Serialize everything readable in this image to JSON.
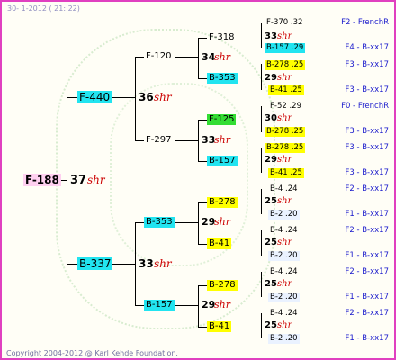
{
  "header": {
    "date_text": "30-  1-2012 ( 21: 22)"
  },
  "footer": {
    "copyright": "Copyright 2004-2012 @ Karl Kehde Foundation."
  },
  "root": {
    "name": "F-188",
    "num": "37",
    "shr": "shr"
  },
  "gen1": [
    {
      "name": "F-440"
    },
    {
      "name": "B-337",
      "num": "33",
      "shr": "shr"
    }
  ],
  "gen1_top_num": "36",
  "gen1_top_shr": "shr",
  "gen2": [
    {
      "name": "F-120",
      "num": "34",
      "shr": "shr"
    },
    {
      "name": "F-297",
      "num": "33",
      "shr": "shr"
    },
    {
      "name": "B-353",
      "num": "29",
      "shr": "shr"
    },
    {
      "name": "B-157",
      "num": "29",
      "shr": "shr"
    }
  ],
  "gen3": [
    {
      "name": "F-318",
      "num": "33",
      "shr": "shr"
    },
    {
      "name": "B-353",
      "num": "29",
      "shr": "shr"
    },
    {
      "name": "F-125",
      "num": "30",
      "shr": "shr"
    },
    {
      "name": "B-157",
      "num": "29",
      "shr": "shr"
    },
    {
      "name": "B-278",
      "num": "25",
      "shr": "shr"
    },
    {
      "name": "B-41",
      "num": "25",
      "shr": "shr"
    },
    {
      "name": "B-278",
      "num": "25",
      "shr": "shr"
    },
    {
      "name": "B-41",
      "num": "25",
      "shr": "shr"
    }
  ],
  "gen4": [
    {
      "name": "F-370 .32",
      "right": "F2 - FrenchR"
    },
    {
      "name": "B-157 .29",
      "right": "F4 - B-xx17"
    },
    {
      "name": "B-278 .25",
      "right": "F3 - B-xx17"
    },
    {
      "name": "B-41 .25",
      "right": "F3 - B-xx17"
    },
    {
      "name": "F-52 .29",
      "right": "F0 - FrenchR"
    },
    {
      "name": "B-278 .25",
      "right": "F3 - B-xx17"
    },
    {
      "name": "B-278 .25",
      "right": "F3 - B-xx17"
    },
    {
      "name": "B-41 .25",
      "right": "F3 - B-xx17"
    },
    {
      "name": "B-4 .24",
      "right": "F2 - B-xx17"
    },
    {
      "name": "B-2 .20",
      "right": "F1 - B-xx17"
    },
    {
      "name": "B-4 .24",
      "right": "F2 - B-xx17"
    },
    {
      "name": "B-2 .20",
      "right": "F1 - B-xx17"
    },
    {
      "name": "B-4 .24",
      "right": "F2 - B-xx17"
    },
    {
      "name": "B-2 .20",
      "right": "F1 - B-xx17"
    },
    {
      "name": "B-4 .24",
      "right": "F2 - B-xx17"
    },
    {
      "name": "B-2 .20",
      "right": "F1 - B-xx17"
    }
  ]
}
